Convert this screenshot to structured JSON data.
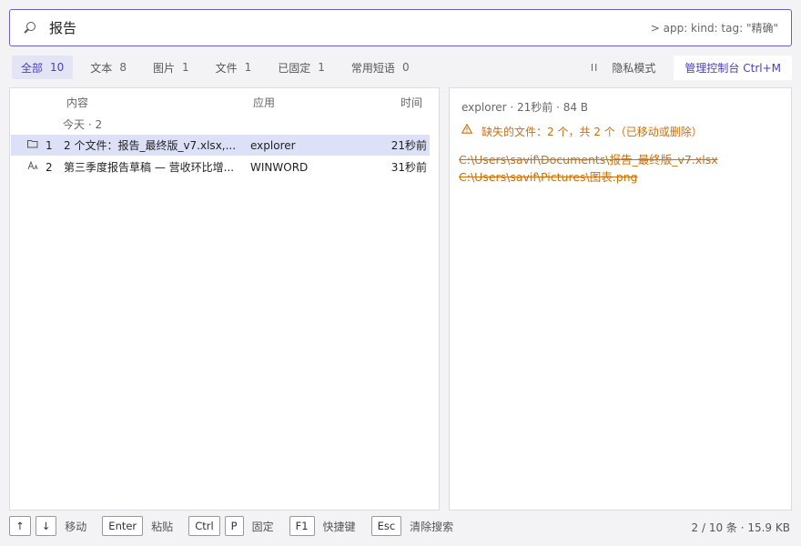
{
  "search": {
    "query": "报告",
    "hint": ">  app:  kind:  tag:  \"精确\""
  },
  "tabs": [
    {
      "label": "全部",
      "count": "10",
      "active": true
    },
    {
      "label": "文本",
      "count": "8"
    },
    {
      "label": "图片",
      "count": "1"
    },
    {
      "label": "文件",
      "count": "1"
    },
    {
      "label": "已固定",
      "count": "1"
    },
    {
      "label": "常用短语",
      "count": "0"
    }
  ],
  "toolbar": {
    "pause_glyph": "II",
    "privacy_label": "隐私模式",
    "console_label": "管理控制台  Ctrl+M"
  },
  "list": {
    "columns": {
      "content": "内容",
      "app": "应用",
      "time": "时间"
    },
    "group_label": "今天  ·  2",
    "rows": [
      {
        "icon": "folder-icon",
        "num": "1",
        "content": "2 个文件：报告_最终版_v7.xlsx,...",
        "app": "explorer",
        "time": "21秒前",
        "selected": true
      },
      {
        "icon": "text-icon",
        "num": "2",
        "content": "第三季度报告草稿 — 营收环比增...",
        "app": "WINWORD",
        "time": "31秒前",
        "selected": false
      }
    ]
  },
  "detail": {
    "meta": "explorer  ·  21秒前  ·  84 B",
    "warning": "缺失的文件：2 个，共 2 个（已移动或删除）",
    "paths": [
      "C:\\Users\\savif\\Documents\\报告_最终版_v7.xlsx",
      "C:\\Users\\savif\\Pictures\\图表.png"
    ]
  },
  "footer": {
    "keys": {
      "up": "↑",
      "down": "↓",
      "move": "移动",
      "enter": "Enter",
      "paste": "粘贴",
      "ctrl": "Ctrl",
      "p": "P",
      "pin": "固定",
      "f1": "F1",
      "shortcuts": "快捷键",
      "esc": "Esc",
      "clear": "清除搜索"
    },
    "status": "2 / 10 条   ·   15.9 KB"
  },
  "colors": {
    "accent": "#4a3fb8",
    "warning": "#c9700f",
    "selected_row": "#dde1f8"
  }
}
